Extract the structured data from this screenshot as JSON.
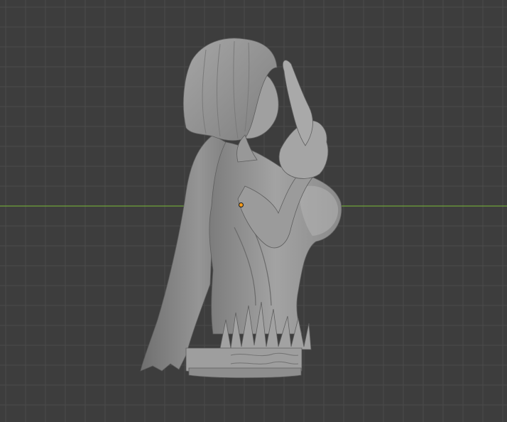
{
  "viewport": {
    "background_color": "#3d3d3d",
    "grid_line_color": "#4a4a4a",
    "x_axis_color": "#6fa33a",
    "object_color": "#9a9a9a",
    "origin_color": "#f29a1b"
  },
  "object": {
    "name": "",
    "selected": false
  }
}
